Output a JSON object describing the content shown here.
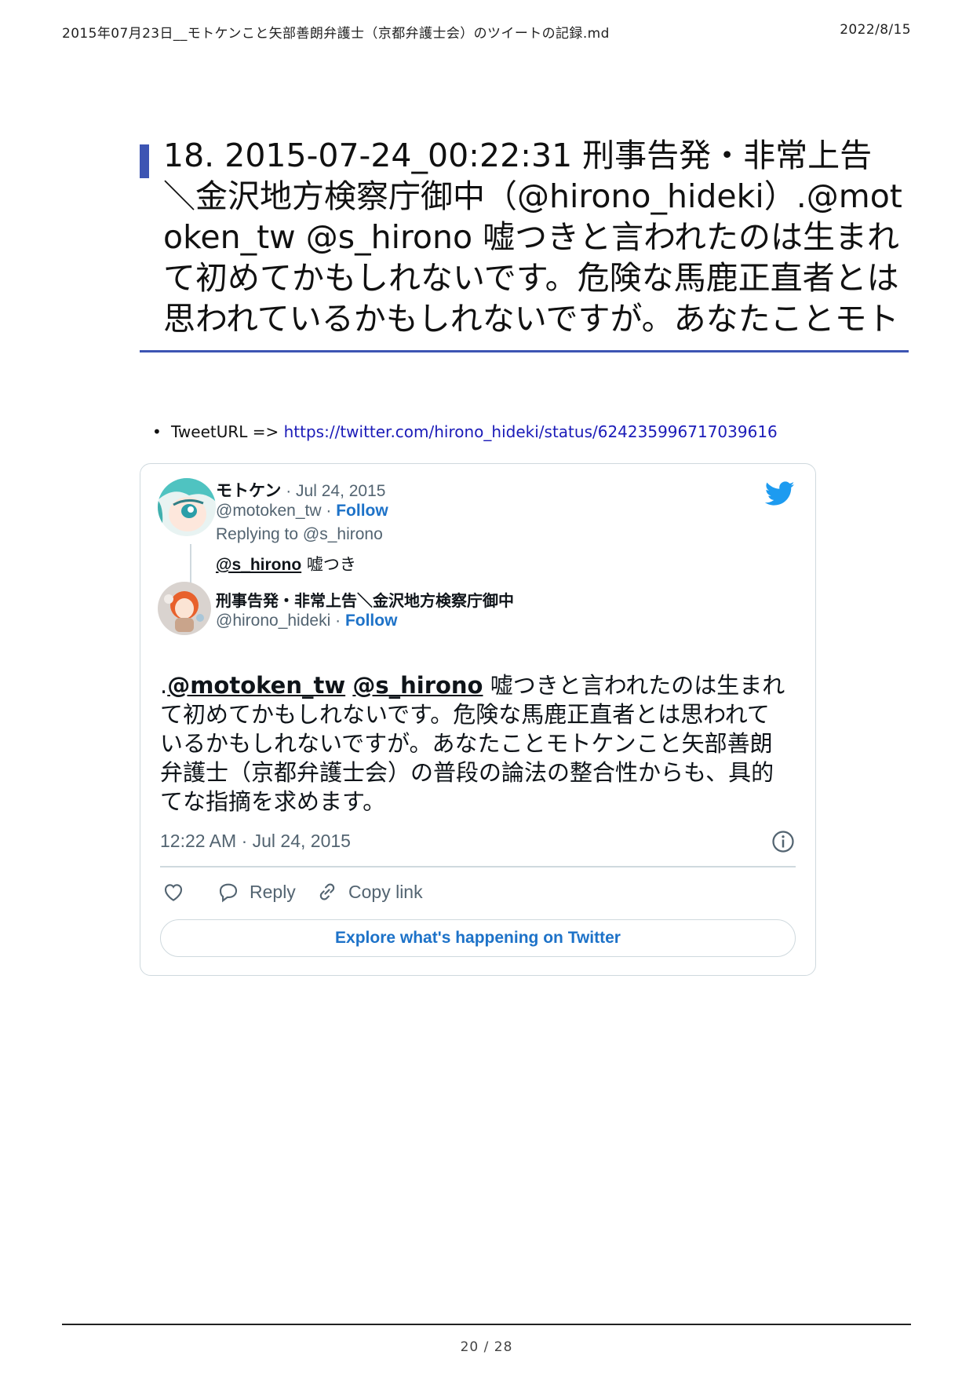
{
  "print_header": {
    "doc_title": "2015年07月23日__モトケンこと矢部善朗弁護士（京都弁護士会）のツイートの記録.md",
    "date": "2022/8/15"
  },
  "heading": {
    "text": "18. 2015-07-24_00:22:31 刑事告発・非常上告＼金沢地方検察庁御中（@hirono_hideki）.@motoken_tw @s_hirono 嘘つきと言われたのは生まれて初めてかもしれないです。危険な馬鹿正直者とは思われているかもしれないですが。あなたことモト"
  },
  "tweet_url": {
    "label": "TweetURL =>",
    "url": "https://twitter.com/hirono_hideki/status/624235996717039616"
  },
  "tweet": {
    "parent": {
      "name": "モトケン",
      "date": "· Jul 24, 2015",
      "handle": "@motoken_tw",
      "follow_sep": "·",
      "follow": "Follow",
      "replying_to": "Replying to @s_hirono",
      "text_mention": "@s_hirono",
      "text": " 嘘つき"
    },
    "main": {
      "name": "刑事告発・非常上告＼金沢地方検察庁御中",
      "handle": "@hirono_hideki",
      "follow_sep": "·",
      "follow": "Follow",
      "text_prefix": ".",
      "mention1": "@motoken_tw",
      "mention2": "@s_hirono",
      "text": " 嘘つきと言われたのは生まれて初めてかもしれないです。危険な馬鹿正直者とは思われているかもしれないですが。あなたことモトケンこと矢部善朗弁護士（京都弁護士会）の普段の論法の整合性からも、具的てな指摘を求めます。"
    },
    "timestamp": "12:22 AM · Jul 24, 2015",
    "actions": {
      "reply": "Reply",
      "copy_link": "Copy link"
    },
    "explore_button": "Explore what's happening on Twitter"
  },
  "icons": {
    "bird": "twitter-bird-icon",
    "info": "info-icon",
    "like": "heart-icon",
    "reply": "reply-bubble-icon",
    "copy": "link-icon"
  },
  "colors": {
    "heading_accent": "#3d55b3",
    "link": "#1b1bb8",
    "twitter_blue": "#1d9bf0",
    "follow_blue": "#1d72c8"
  },
  "page": {
    "number": "20 / 28"
  }
}
